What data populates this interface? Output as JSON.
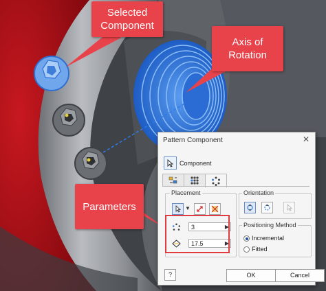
{
  "callouts": {
    "selected_component": "Selected\nComponent",
    "axis_of_rotation": "Axis of\nRotation",
    "parameters": "Parameters"
  },
  "dialog": {
    "title": "Pattern Component",
    "close_glyph": "✕",
    "component_label": "Component",
    "tabs": [
      {
        "icon": "rectangular-pattern-icon",
        "active": false
      },
      {
        "icon": "grid-pattern-icon",
        "active": false
      },
      {
        "icon": "circular-pattern-icon",
        "active": true
      }
    ],
    "placement": {
      "label": "Placement",
      "count_value": "3",
      "angle_value": "17.5"
    },
    "orientation": {
      "label": "Orientation"
    },
    "positioning": {
      "label": "Positioning Method",
      "options": [
        "Incremental",
        "Fitted"
      ],
      "selected": "Incremental"
    },
    "buttons": {
      "help": "?",
      "ok": "OK",
      "cancel": "Cancel"
    }
  },
  "colors": {
    "callout": "#e8434a",
    "red_body": "#b3121a",
    "steel": "#8a8e93",
    "highlight_blue": "#3a7fe0"
  }
}
